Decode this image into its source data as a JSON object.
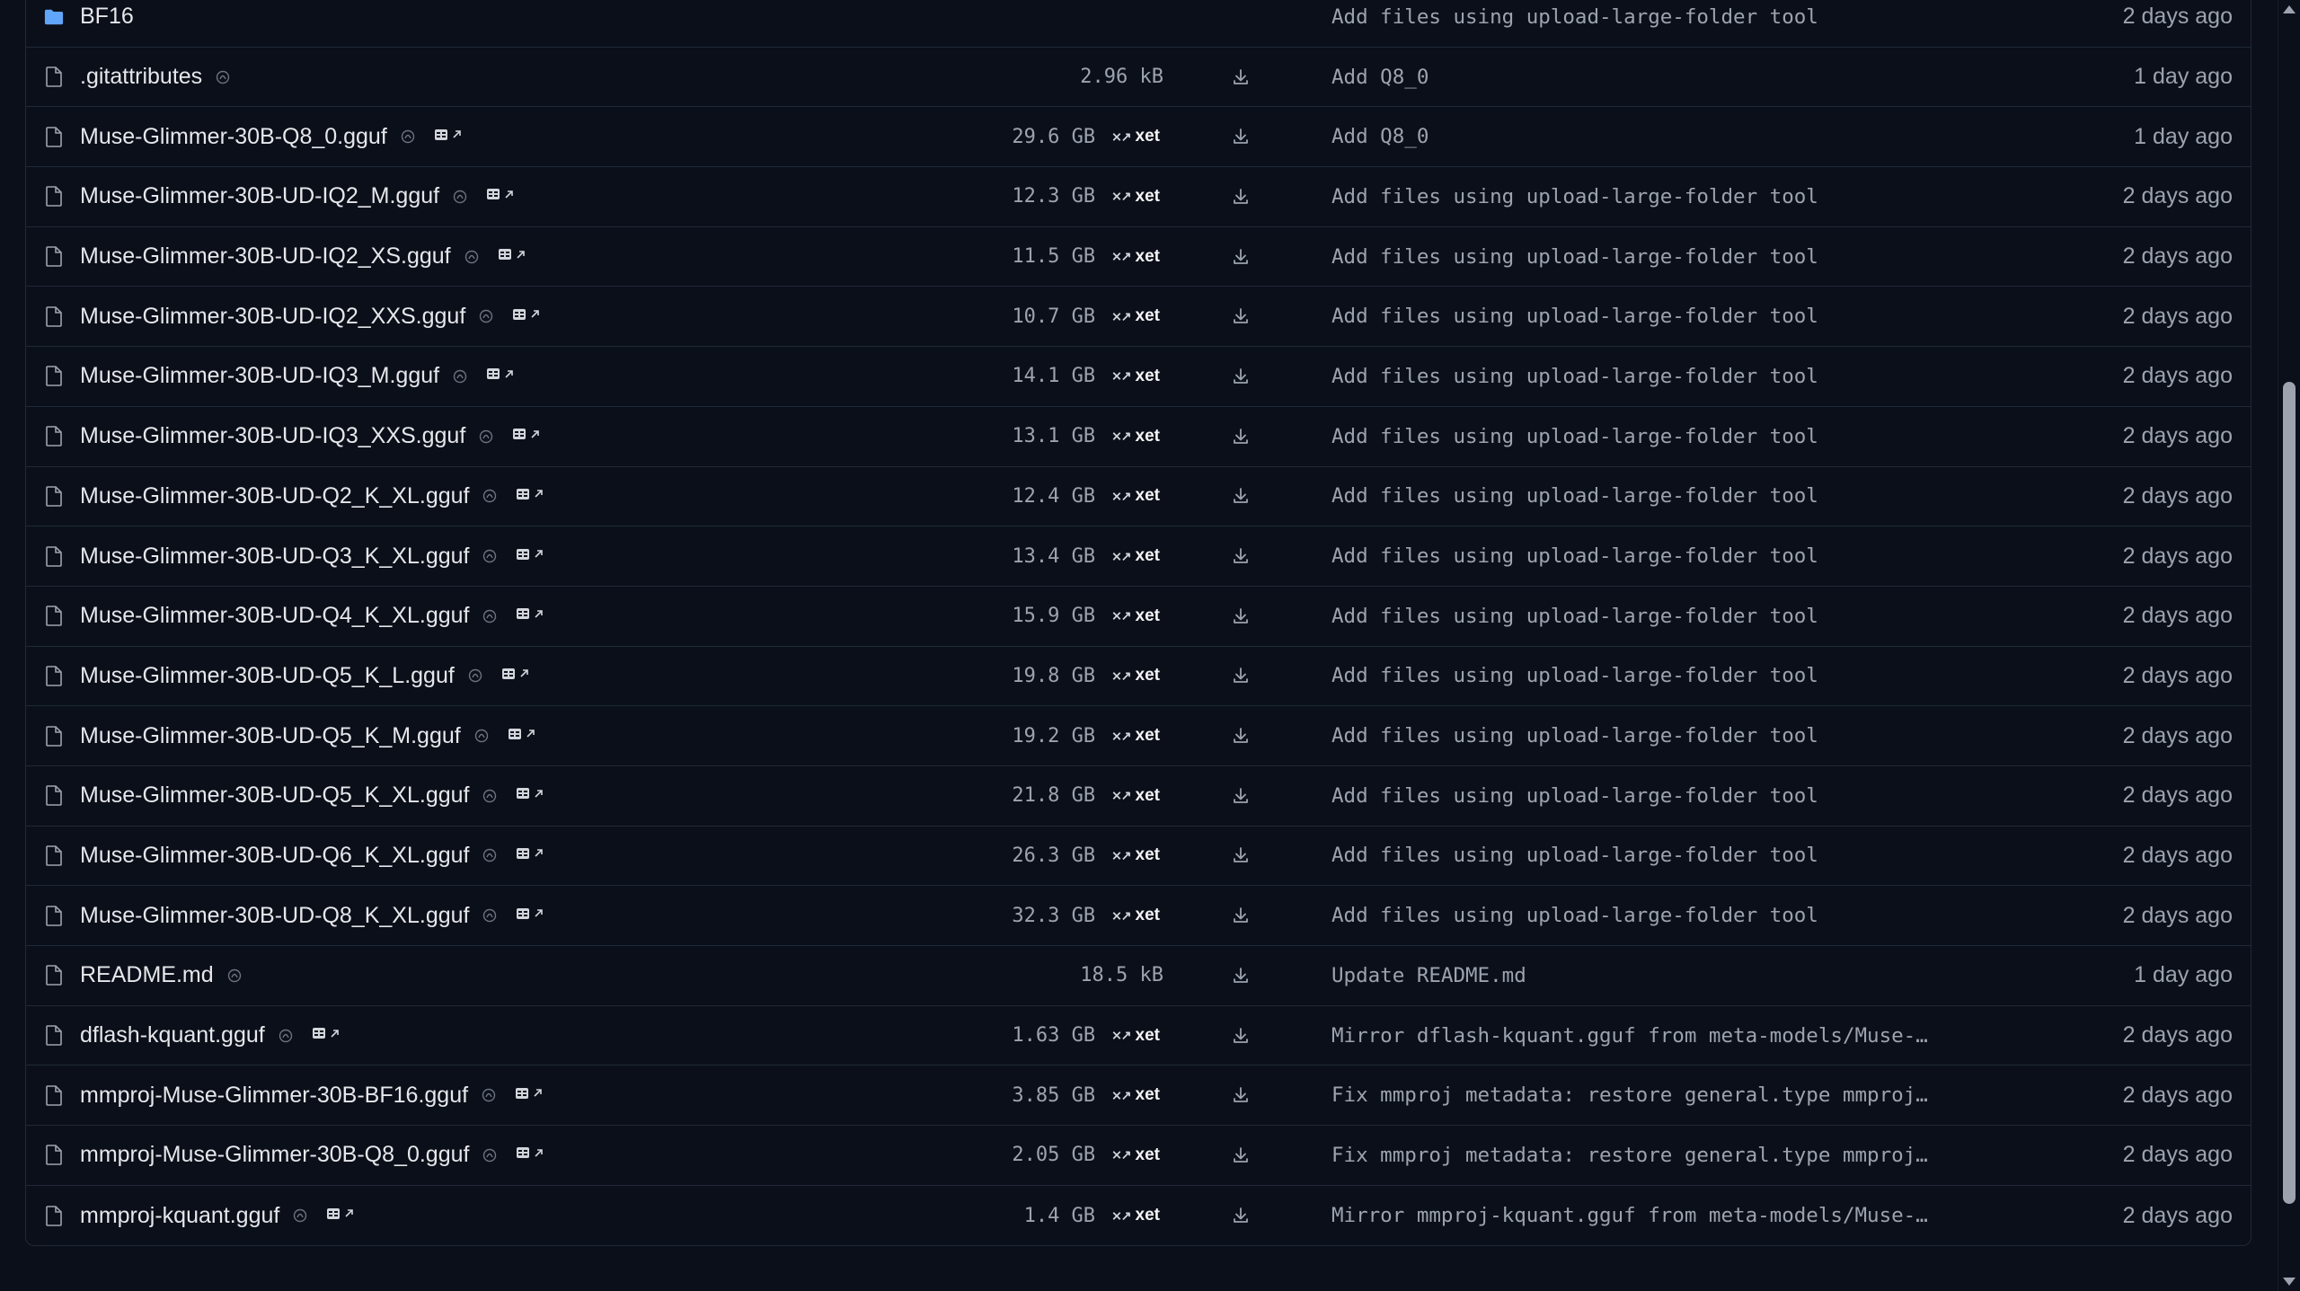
{
  "files": [
    {
      "type": "folder",
      "name": "BF16",
      "size": "",
      "xet": false,
      "lfs": false,
      "viewer": false,
      "download": false,
      "commit": "Add files using upload-large-folder tool",
      "date": "2 days ago"
    },
    {
      "type": "file",
      "name": ".gitattributes",
      "size": "2.96 kB",
      "xet": false,
      "lfs": true,
      "viewer": false,
      "download": true,
      "commit": "Add Q8_0",
      "date": "1 day ago"
    },
    {
      "type": "file",
      "name": "Muse-Glimmer-30B-Q8_0.gguf",
      "size": "29.6 GB",
      "xet": true,
      "lfs": true,
      "viewer": true,
      "download": true,
      "commit": "Add Q8_0",
      "date": "1 day ago"
    },
    {
      "type": "file",
      "name": "Muse-Glimmer-30B-UD-IQ2_M.gguf",
      "size": "12.3 GB",
      "xet": true,
      "lfs": true,
      "viewer": true,
      "download": true,
      "commit": "Add files using upload-large-folder tool",
      "date": "2 days ago"
    },
    {
      "type": "file",
      "name": "Muse-Glimmer-30B-UD-IQ2_XS.gguf",
      "size": "11.5 GB",
      "xet": true,
      "lfs": true,
      "viewer": true,
      "download": true,
      "commit": "Add files using upload-large-folder tool",
      "date": "2 days ago"
    },
    {
      "type": "file",
      "name": "Muse-Glimmer-30B-UD-IQ2_XXS.gguf",
      "size": "10.7 GB",
      "xet": true,
      "lfs": true,
      "viewer": true,
      "download": true,
      "commit": "Add files using upload-large-folder tool",
      "date": "2 days ago"
    },
    {
      "type": "file",
      "name": "Muse-Glimmer-30B-UD-IQ3_M.gguf",
      "size": "14.1 GB",
      "xet": true,
      "lfs": true,
      "viewer": true,
      "download": true,
      "commit": "Add files using upload-large-folder tool",
      "date": "2 days ago"
    },
    {
      "type": "file",
      "name": "Muse-Glimmer-30B-UD-IQ3_XXS.gguf",
      "size": "13.1 GB",
      "xet": true,
      "lfs": true,
      "viewer": true,
      "download": true,
      "commit": "Add files using upload-large-folder tool",
      "date": "2 days ago"
    },
    {
      "type": "file",
      "name": "Muse-Glimmer-30B-UD-Q2_K_XL.gguf",
      "size": "12.4 GB",
      "xet": true,
      "lfs": true,
      "viewer": true,
      "download": true,
      "commit": "Add files using upload-large-folder tool",
      "date": "2 days ago"
    },
    {
      "type": "file",
      "name": "Muse-Glimmer-30B-UD-Q3_K_XL.gguf",
      "size": "13.4 GB",
      "xet": true,
      "lfs": true,
      "viewer": true,
      "download": true,
      "commit": "Add files using upload-large-folder tool",
      "date": "2 days ago"
    },
    {
      "type": "file",
      "name": "Muse-Glimmer-30B-UD-Q4_K_XL.gguf",
      "size": "15.9 GB",
      "xet": true,
      "lfs": true,
      "viewer": true,
      "download": true,
      "commit": "Add files using upload-large-folder tool",
      "date": "2 days ago"
    },
    {
      "type": "file",
      "name": "Muse-Glimmer-30B-UD-Q5_K_L.gguf",
      "size": "19.8 GB",
      "xet": true,
      "lfs": true,
      "viewer": true,
      "download": true,
      "commit": "Add files using upload-large-folder tool",
      "date": "2 days ago"
    },
    {
      "type": "file",
      "name": "Muse-Glimmer-30B-UD-Q5_K_M.gguf",
      "size": "19.2 GB",
      "xet": true,
      "lfs": true,
      "viewer": true,
      "download": true,
      "commit": "Add files using upload-large-folder tool",
      "date": "2 days ago"
    },
    {
      "type": "file",
      "name": "Muse-Glimmer-30B-UD-Q5_K_XL.gguf",
      "size": "21.8 GB",
      "xet": true,
      "lfs": true,
      "viewer": true,
      "download": true,
      "commit": "Add files using upload-large-folder tool",
      "date": "2 days ago"
    },
    {
      "type": "file",
      "name": "Muse-Glimmer-30B-UD-Q6_K_XL.gguf",
      "size": "26.3 GB",
      "xet": true,
      "lfs": true,
      "viewer": true,
      "download": true,
      "commit": "Add files using upload-large-folder tool",
      "date": "2 days ago"
    },
    {
      "type": "file",
      "name": "Muse-Glimmer-30B-UD-Q8_K_XL.gguf",
      "size": "32.3 GB",
      "xet": true,
      "lfs": true,
      "viewer": true,
      "download": true,
      "commit": "Add files using upload-large-folder tool",
      "date": "2 days ago"
    },
    {
      "type": "file",
      "name": "README.md",
      "size": "18.5 kB",
      "xet": false,
      "lfs": true,
      "viewer": false,
      "download": true,
      "commit": "Update README.md",
      "date": "1 day ago"
    },
    {
      "type": "file",
      "name": "dflash-kquant.gguf",
      "size": "1.63 GB",
      "xet": true,
      "lfs": true,
      "viewer": true,
      "download": true,
      "commit": "Mirror dflash-kquant.gguf from meta-models/Muse-…",
      "date": "2 days ago"
    },
    {
      "type": "file",
      "name": "mmproj-Muse-Glimmer-30B-BF16.gguf",
      "size": "3.85 GB",
      "xet": true,
      "lfs": true,
      "viewer": true,
      "download": true,
      "commit": "Fix mmproj metadata: restore general.type mmproj…",
      "date": "2 days ago"
    },
    {
      "type": "file",
      "name": "mmproj-Muse-Glimmer-30B-Q8_0.gguf",
      "size": "2.05 GB",
      "xet": true,
      "lfs": true,
      "viewer": true,
      "download": true,
      "commit": "Fix mmproj metadata: restore general.type mmproj…",
      "date": "2 days ago"
    },
    {
      "type": "file",
      "name": "mmproj-kquant.gguf",
      "size": "1.4 GB",
      "xet": true,
      "lfs": true,
      "viewer": true,
      "download": true,
      "commit": "Mirror mmproj-kquant.gguf from meta-models/Muse-…",
      "date": "2 days ago"
    }
  ],
  "xet_label": "xet",
  "icons": {
    "folder": "folder-icon",
    "file": "file-icon",
    "lfs": "lfs-icon",
    "viewer": "viewer-icon",
    "external": "external-link-icon",
    "download": "download-icon",
    "xet": "xet-icon"
  },
  "colors": {
    "background": "#0b0f19",
    "row_border": "#1f2937",
    "text_primary": "#e5e7eb",
    "text_muted": "#9ca3af",
    "folder_blue": "#60a5fa"
  }
}
